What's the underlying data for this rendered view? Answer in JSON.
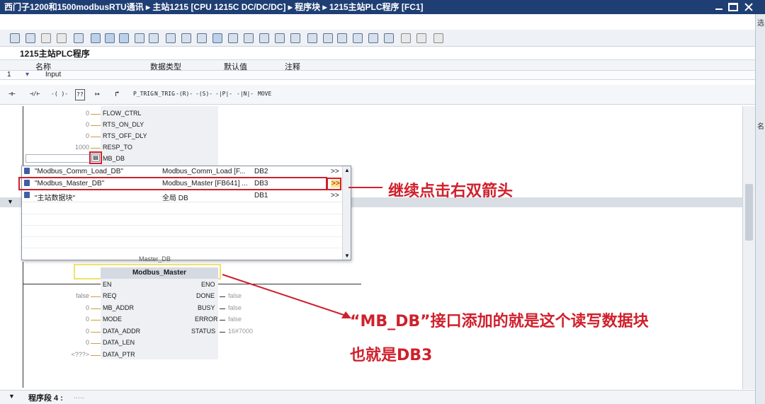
{
  "window": {
    "title": "西门子1200和1500modbusRTU通讯 ▸ 主站1215 [CPU 1215C DC/DC/DC] ▸ 程序块 ▸ 1215主站PLC程序 [FC1]"
  },
  "right_panel": {
    "label_top": "选",
    "label_mid": "名"
  },
  "block": {
    "title": "1215主站PLC程序",
    "columns": [
      "名称",
      "数据类型",
      "默认值",
      "注释"
    ],
    "first_row": {
      "num": "1",
      "name": "Input"
    }
  },
  "ladder_toolbar": [
    "⊣⊢",
    "⊣/⊢",
    "-( )-",
    "??",
    "↦",
    "↱",
    "P_TRIG",
    "N_TRIG",
    "-(R)-",
    "-(S)-",
    "-|P|-",
    "-|N|-",
    "MOVE"
  ],
  "upper_block": {
    "pins": [
      {
        "value": "0",
        "name": "FLOW_CTRL"
      },
      {
        "value": "0",
        "name": "RTS_ON_DLY"
      },
      {
        "value": "0",
        "name": "RTS_OFF_DLY"
      },
      {
        "value": "1000",
        "name": "RESP_TO"
      },
      {
        "value": "",
        "name": "MB_DB"
      }
    ]
  },
  "dropdown": {
    "rows": [
      {
        "name": "\"Modbus_Comm_Load_DB\"",
        "type": "Modbus_Comm_Load [F...",
        "db": "DB2",
        "arrow": ">>"
      },
      {
        "name": "\"Modbus_Master_DB\"",
        "type": "Modbus_Master [FB641] ...",
        "db": "DB3",
        "arrow": ">>"
      },
      {
        "name": "\"主站数据块\"",
        "type": "全局 DB",
        "db": "DB1",
        "arrow": ">>"
      }
    ]
  },
  "lower_block": {
    "instance": "Master_DB",
    "name": "Modbus_Master",
    "en": "EN",
    "eno": "ENO",
    "inputs": [
      {
        "value": "false",
        "name": "REQ"
      },
      {
        "value": "0",
        "name": "MB_ADDR"
      },
      {
        "value": "0",
        "name": "MODE"
      },
      {
        "value": "0",
        "name": "DATA_ADDR"
      },
      {
        "value": "0",
        "name": "DATA_LEN"
      },
      {
        "value": "<???>",
        "name": "DATA_PTR"
      }
    ],
    "outputs": [
      {
        "name": "DONE",
        "value": "false"
      },
      {
        "name": "BUSY",
        "value": "false"
      },
      {
        "name": "ERROR",
        "value": "false"
      },
      {
        "name": "STATUS",
        "value": "16#7000"
      }
    ]
  },
  "segment": {
    "label": "程序段 4 :",
    "dots": "....."
  },
  "annotations": {
    "callout1": "继续点击右双箭头",
    "callout2_line1": "“MB_DB”接口添加的就是这个读写数据块",
    "callout2_line2": "也就是DB3",
    "color": "#d0202c"
  }
}
